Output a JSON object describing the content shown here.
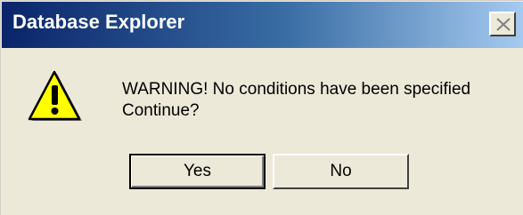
{
  "window": {
    "title": "Database Explorer",
    "close_icon": "close-icon"
  },
  "message": {
    "icon": "warning-icon",
    "line1": "WARNING! No conditions have been specified",
    "line2": "Continue?"
  },
  "buttons": {
    "yes_label": "Yes",
    "no_label": "No"
  },
  "colors": {
    "titlebar_start": "#0a246a",
    "titlebar_end": "#a6caf0",
    "dialog_bg": "#ece9d8",
    "warning_yellow": "#ffff00"
  }
}
